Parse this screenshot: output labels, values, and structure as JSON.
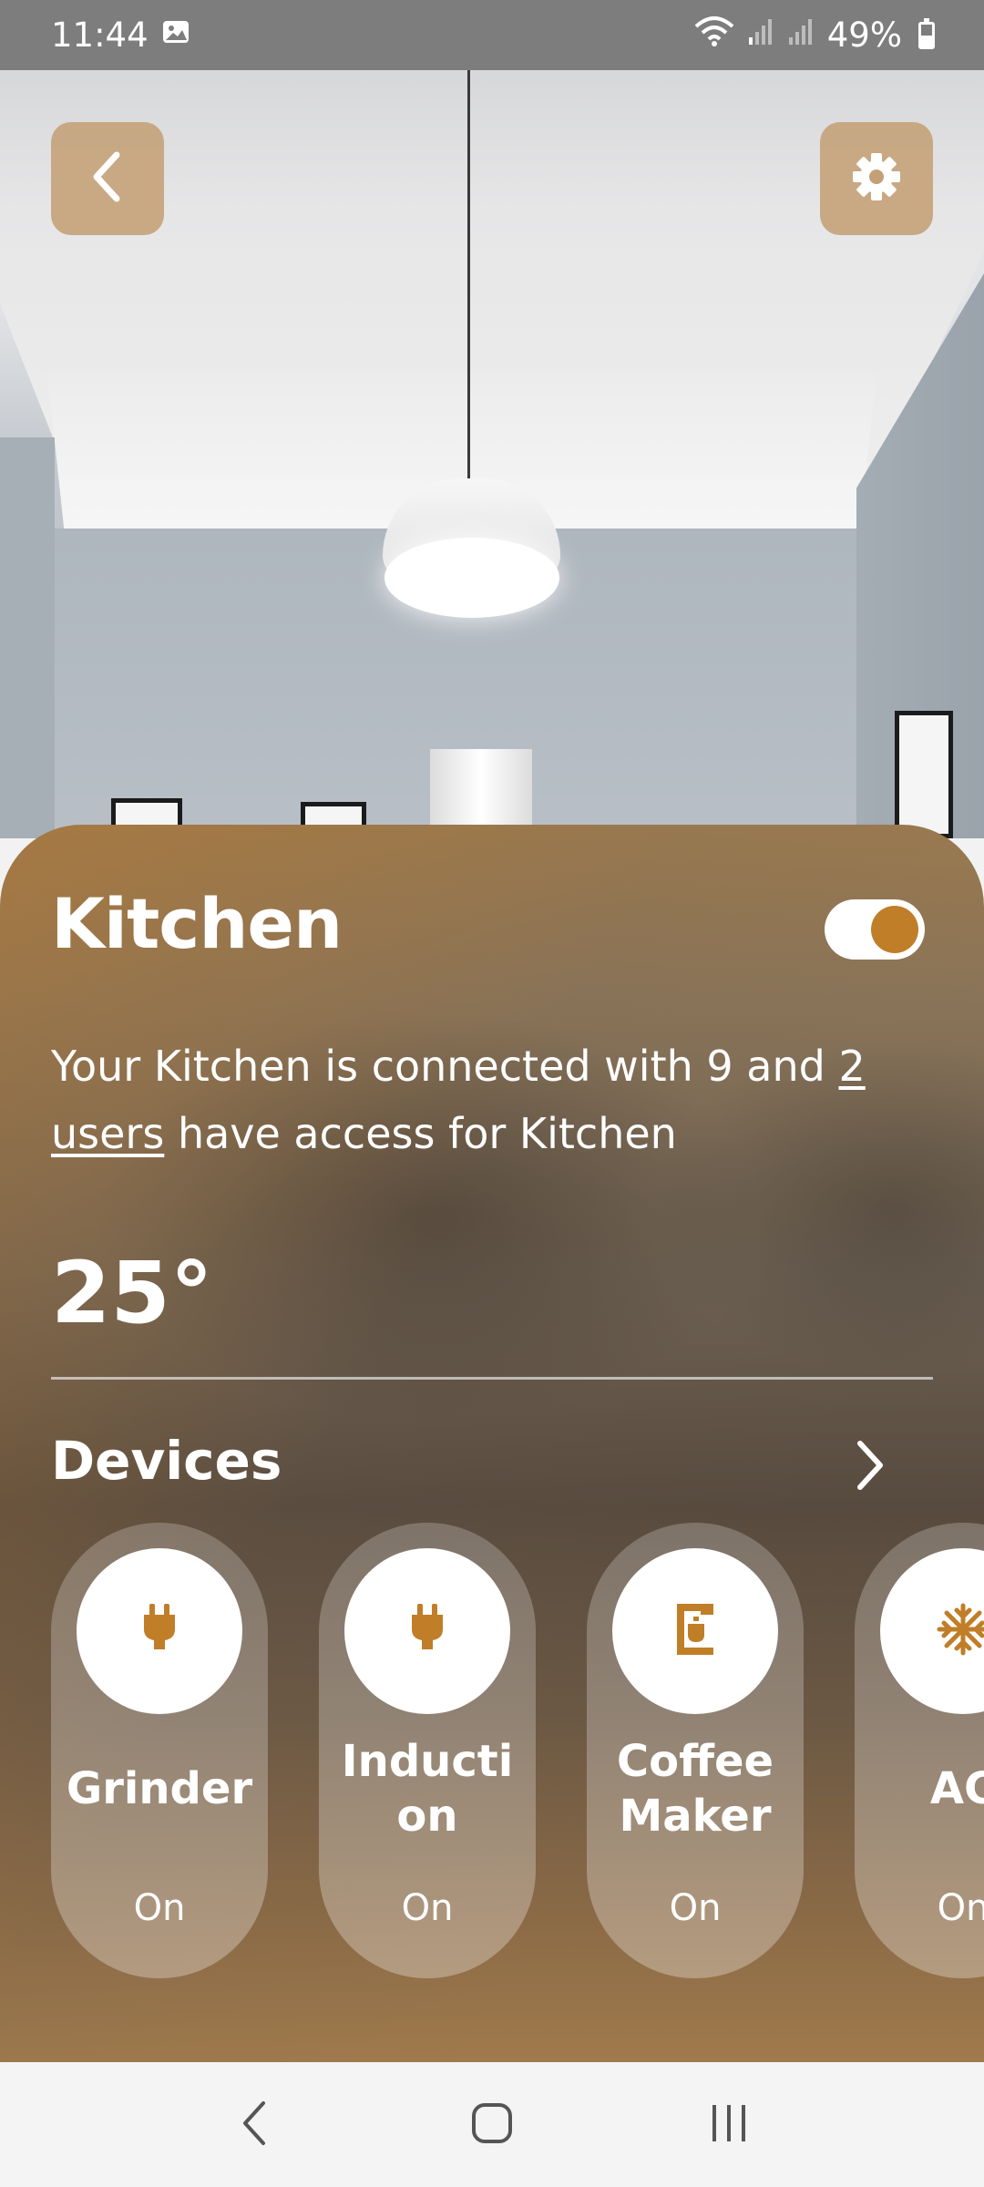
{
  "status_bar": {
    "time": "11:44",
    "battery": "49%",
    "icons": [
      "gallery-icon",
      "wifi-icon",
      "signal-icon",
      "signal-icon",
      "battery-icon"
    ]
  },
  "header": {
    "back_icon": "chevron-left-icon",
    "settings_icon": "gear-icon",
    "button_color": "#c4a076"
  },
  "room": {
    "name": "Kitchen",
    "power_on": true,
    "description_before": "Your Kitchen is connected with 9 and",
    "users_link": "2 users",
    "description_after": "have access for Kitchen",
    "temperature": "25°"
  },
  "devices": {
    "title": "Devices",
    "more_icon": "chevron-right-icon",
    "items": [
      {
        "name": "Grinder",
        "status": "On",
        "icon": "plug-icon"
      },
      {
        "name": "Inducti\non",
        "status": "On",
        "icon": "plug-icon"
      },
      {
        "name": "Coffee\nMaker",
        "status": "On",
        "icon": "coffee-maker-icon"
      },
      {
        "name": "AC",
        "status": "On",
        "icon": "snowflake-icon"
      }
    ]
  },
  "colors": {
    "accent": "#c07e28",
    "text": "#ffffff"
  },
  "nav": {
    "items": [
      "nav-back-icon",
      "nav-home-icon",
      "nav-recents-icon"
    ]
  }
}
